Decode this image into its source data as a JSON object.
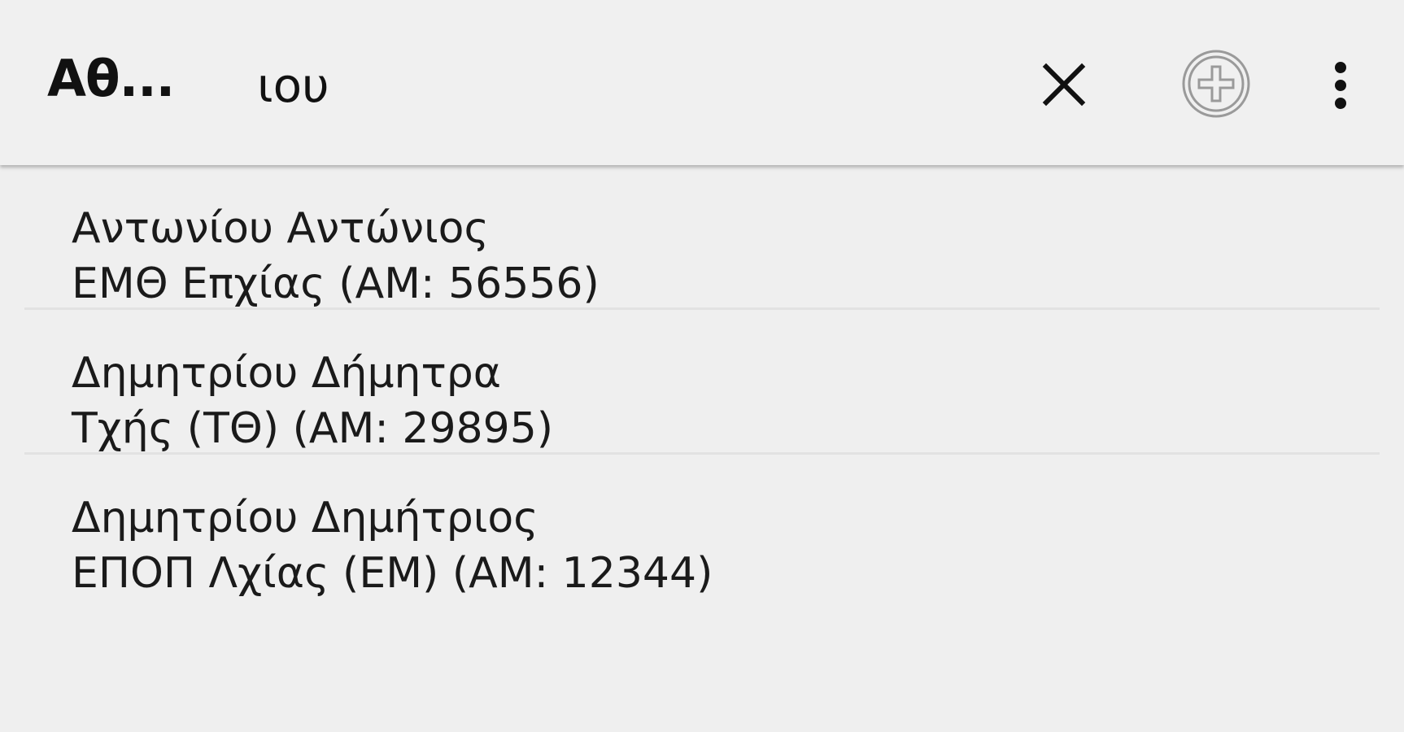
{
  "toolbar": {
    "title": "Αθ...",
    "search": {
      "value": "ιου",
      "placeholder": ""
    },
    "actions": {
      "clear_icon": "close-icon",
      "add_icon": "add-circle-icon",
      "overflow_icon": "more-vert-icon"
    }
  },
  "results": [
    {
      "name": "Αντωνίου Αντώνιος",
      "detail": "ΕΜΘ Επχίας (ΑΜ: 56556)"
    },
    {
      "name": "Δημητρίου Δήμητρα",
      "detail": "Τχής (ΤΘ) (ΑΜ: 29895)"
    },
    {
      "name": "Δημητρίου Δημήτριος",
      "detail": "ΕΠΟΠ Λχίας (ΕΜ) (ΑΜ: 12344)"
    }
  ],
  "colors": {
    "background": "#efefef",
    "toolbar": "#f0f0f0",
    "text": "#111111",
    "divider": "#e2e2e2",
    "add_icon": "#9a9a9a"
  }
}
